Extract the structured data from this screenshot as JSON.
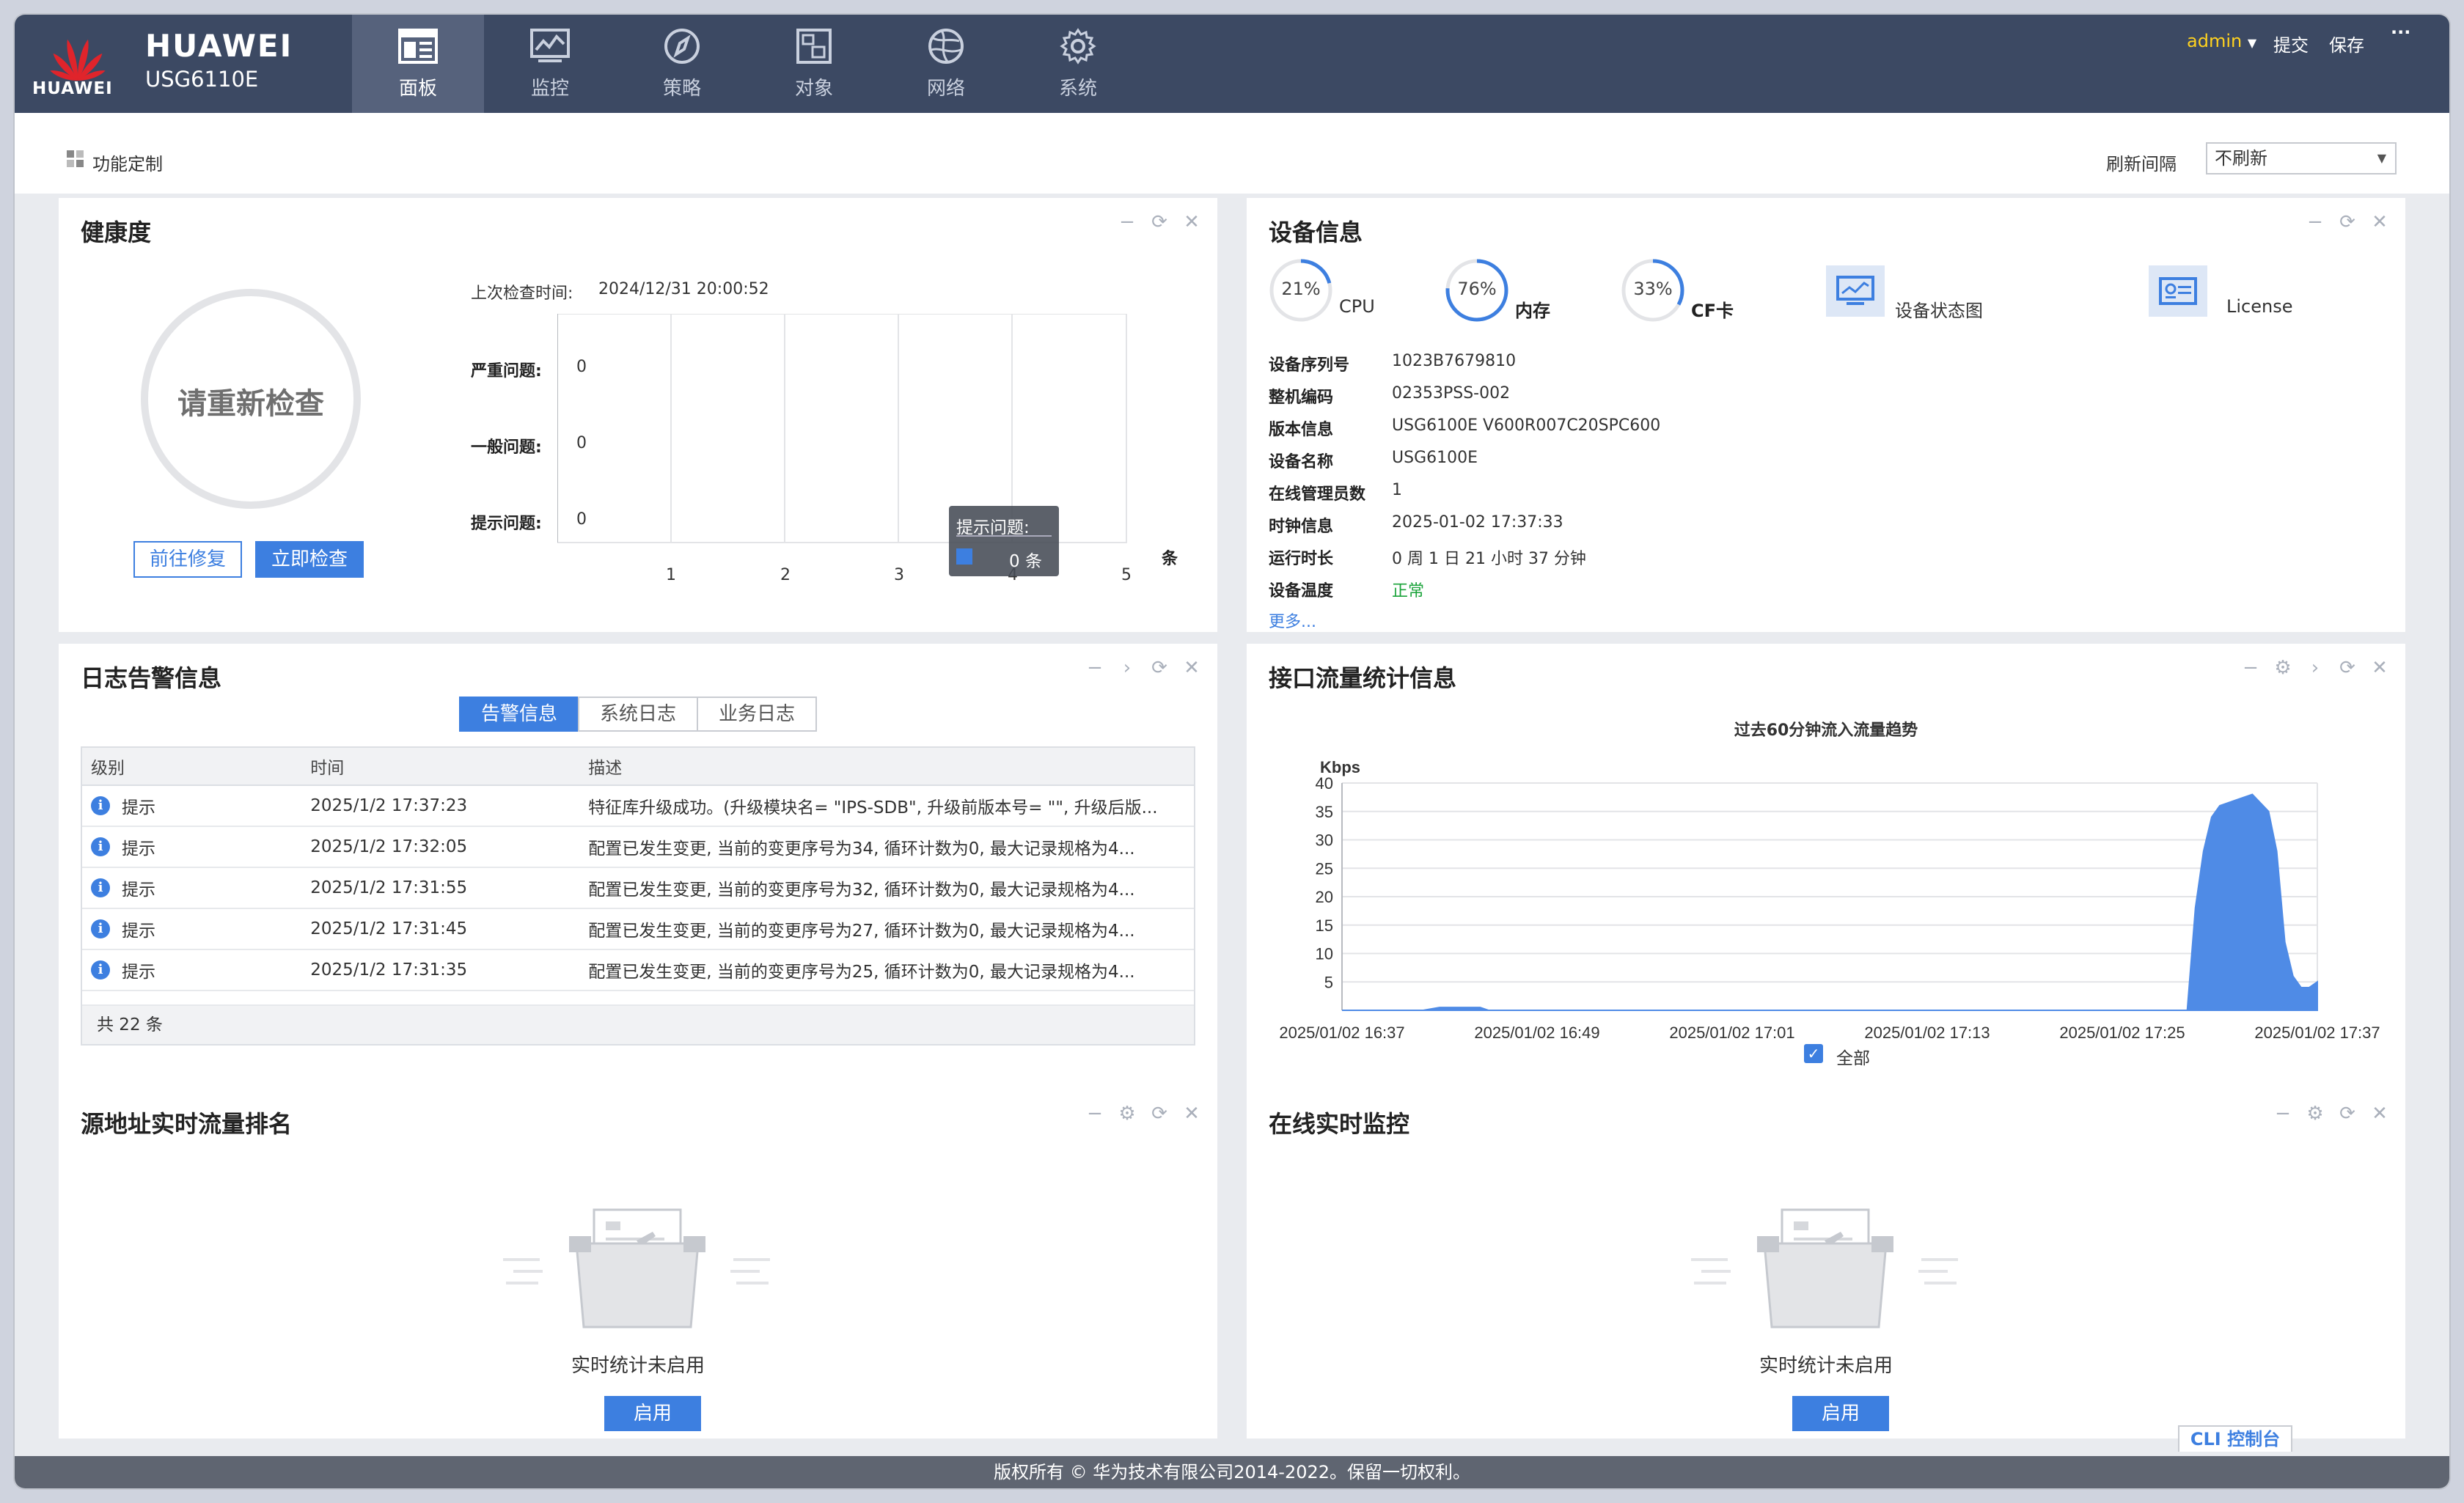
{
  "brand": {
    "logo_text": "HUAWEI",
    "name": "HUAWEI",
    "model": "USG6110E"
  },
  "nav": [
    {
      "label": "面板",
      "icon": "dashboard-icon",
      "active": true
    },
    {
      "label": "监控",
      "icon": "monitor-icon",
      "active": false
    },
    {
      "label": "策略",
      "icon": "compass-icon",
      "active": false
    },
    {
      "label": "对象",
      "icon": "object-icon",
      "active": false
    },
    {
      "label": "网络",
      "icon": "globe-icon",
      "active": false
    },
    {
      "label": "系统",
      "icon": "gear-icon",
      "active": false
    }
  ],
  "header_right": {
    "user": "admin",
    "commit": "提交",
    "save": "保存",
    "more": "···"
  },
  "toolbar": {
    "customize": "功能定制",
    "refresh_label": "刷新间隔",
    "refresh_value": "不刷新"
  },
  "health": {
    "title": "健康度",
    "circle_text": "请重新检查",
    "fix_button": "前往修复",
    "check_button": "立即检查",
    "last_check_label": "上次检查时间:",
    "last_check_time": "2024/12/31 20:00:52",
    "rows": [
      {
        "label": "严重问题:",
        "value": "0"
      },
      {
        "label": "一般问题:",
        "value": "0"
      },
      {
        "label": "提示问题:",
        "value": "0"
      }
    ],
    "ticks": [
      "1",
      "2",
      "3",
      "4",
      "5"
    ],
    "unit": "条",
    "tooltip_title": "提示问题:",
    "tooltip_value": "0 条"
  },
  "device": {
    "title": "设备信息",
    "rings": [
      {
        "pct": "21%",
        "value": 0.21,
        "label": "CPU"
      },
      {
        "pct": "76%",
        "value": 0.76,
        "label": "内存"
      },
      {
        "pct": "33%",
        "value": 0.33,
        "label": "CF卡"
      }
    ],
    "status_map": "设备状态图",
    "license": "License",
    "fields": [
      {
        "k": "设备序列号",
        "v": "1023B7679810"
      },
      {
        "k": "整机编码",
        "v": "02353PSS-002"
      },
      {
        "k": "版本信息",
        "v": "USG6100E V600R007C20SPC600"
      },
      {
        "k": "设备名称",
        "v": "USG6100E"
      },
      {
        "k": "在线管理员数",
        "v": "1"
      },
      {
        "k": "时钟信息",
        "v": "2025-01-02 17:37:33"
      },
      {
        "k": "运行时长",
        "v": "0 周 1 日 21 小时 37 分钟"
      },
      {
        "k": "设备温度",
        "v": "正常"
      }
    ],
    "more": "更多..."
  },
  "logs": {
    "title": "日志告警信息",
    "tabs": [
      "告警信息",
      "系统日志",
      "业务日志"
    ],
    "headers": [
      "级别",
      "时间",
      "描述"
    ],
    "rows": [
      {
        "level": "提示",
        "time": "2025/1/2 17:37:23",
        "desc": "特征库升级成功。(升级模块名= \"IPS-SDB\", 升级前版本号= \"\", 升级后版..."
      },
      {
        "level": "提示",
        "time": "2025/1/2 17:32:05",
        "desc": "配置已发生变更, 当前的变更序号为34, 循环计数为0, 最大记录规格为4..."
      },
      {
        "level": "提示",
        "time": "2025/1/2 17:31:55",
        "desc": "配置已发生变更, 当前的变更序号为32, 循环计数为0, 最大记录规格为4..."
      },
      {
        "level": "提示",
        "time": "2025/1/2 17:31:45",
        "desc": "配置已发生变更, 当前的变更序号为27, 循环计数为0, 最大记录规格为4..."
      },
      {
        "level": "提示",
        "time": "2025/1/2 17:31:35",
        "desc": "配置已发生变更, 当前的变更序号为25, 循环计数为0, 最大记录规格为4..."
      }
    ],
    "total": "共 22 条"
  },
  "traffic": {
    "title": "接口流量统计信息",
    "legend_all": "全部"
  },
  "chart_data": {
    "type": "area",
    "title": "过去60分钟流入流量趋势",
    "ylabel": "Kbps",
    "ylim": [
      0,
      40
    ],
    "yticks": [
      5,
      10,
      15,
      20,
      25,
      30,
      35,
      40
    ],
    "xlabels": [
      "2025/01/02 16:37",
      "2025/01/02 16:49",
      "2025/01/02 17:01",
      "2025/01/02 17:13",
      "2025/01/02 17:25",
      "2025/01/02 17:37"
    ],
    "x_minutes": [
      0,
      5,
      6,
      7.5,
      8.5,
      9,
      52,
      52.5,
      53,
      53.5,
      54,
      55,
      56,
      57,
      57.5,
      58,
      58.5,
      59,
      59.5,
      60
    ],
    "values": [
      0,
      0,
      0.5,
      0.5,
      0.5,
      0,
      0,
      18,
      28,
      34,
      36,
      37,
      38,
      35,
      28,
      12,
      6,
      4,
      4,
      5
    ],
    "series_name": "全部",
    "color": "#4f8be6",
    "grid": true
  },
  "src_rank": {
    "title": "源地址实时流量排名",
    "empty_text": "实时统计未启用",
    "enable_button": "启用"
  },
  "online": {
    "title": "在线实时监控",
    "empty_text": "实时统计未启用",
    "enable_button": "启用"
  },
  "footer": {
    "text": "版权所有 © 华为技术有限公司2014-2022。保留一切权利。",
    "cli": "CLI 控制台"
  }
}
